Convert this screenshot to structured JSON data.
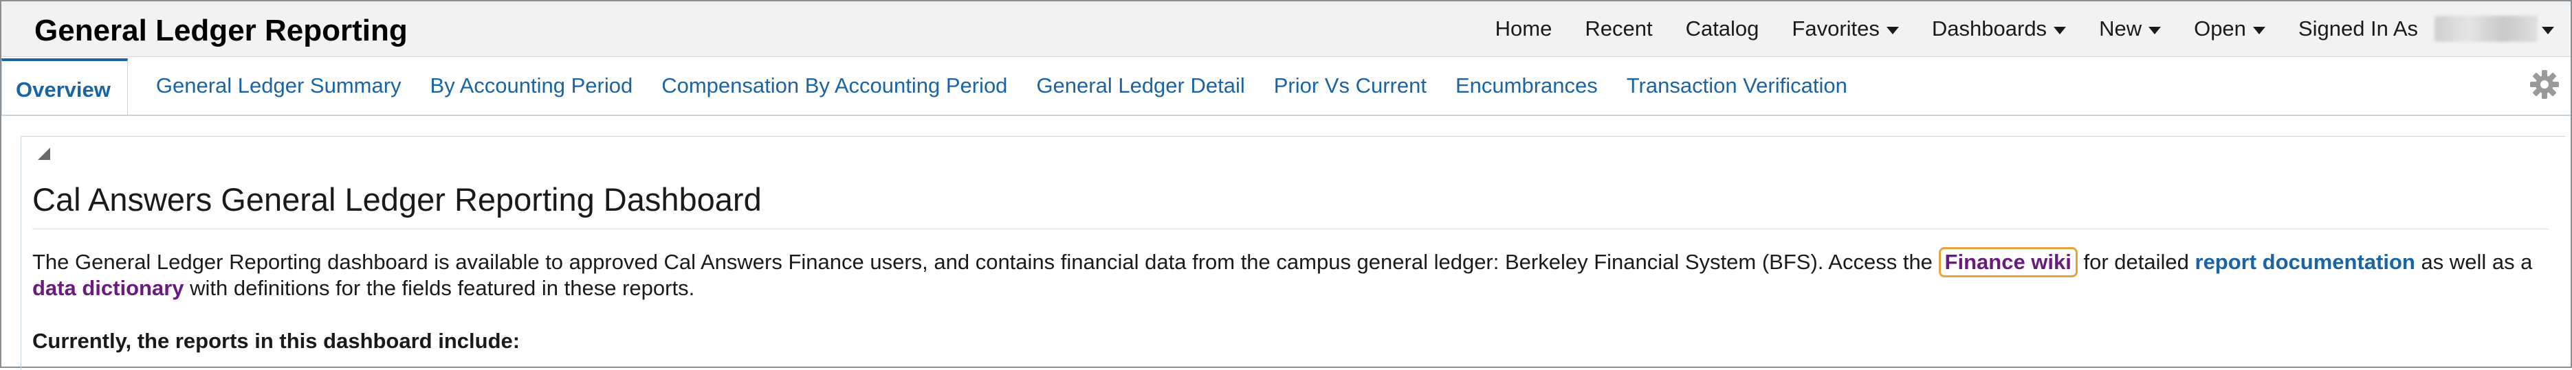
{
  "header": {
    "app_title": "General Ledger Reporting",
    "nav": [
      {
        "label": "Home",
        "dropdown": false
      },
      {
        "label": "Recent",
        "dropdown": false
      },
      {
        "label": "Catalog",
        "dropdown": false
      },
      {
        "label": "Favorites",
        "dropdown": true
      },
      {
        "label": "Dashboards",
        "dropdown": true
      },
      {
        "label": "New",
        "dropdown": true
      },
      {
        "label": "Open",
        "dropdown": true
      }
    ],
    "signed_in_label": "Signed In As"
  },
  "tabs": [
    {
      "label": "Overview",
      "active": true
    },
    {
      "label": "General Ledger Summary",
      "active": false
    },
    {
      "label": "By Accounting Period",
      "active": false
    },
    {
      "label": "Compensation By Accounting Period",
      "active": false
    },
    {
      "label": "General Ledger Detail",
      "active": false
    },
    {
      "label": "Prior Vs Current",
      "active": false
    },
    {
      "label": "Encumbrances",
      "active": false
    },
    {
      "label": "Transaction Verification",
      "active": false
    }
  ],
  "content": {
    "title": "Cal Answers General Ledger Reporting Dashboard",
    "para_text_1": "The General Ledger Reporting dashboard is available to approved Cal Answers Finance users, and contains financial data from the campus general ledger: Berkeley Financial System (BFS). Access the ",
    "link_finance_wiki": "Finance wiki",
    "para_text_2": " for detailed ",
    "link_report_documentation": "report documentation",
    "para_text_3": " as well as a ",
    "link_data_dictionary": "data dictionary",
    "para_text_4": " with definitions for the fields featured in these reports.",
    "subheading": "Currently, the reports in this dashboard include:"
  },
  "colors": {
    "accent_blue": "#1a64a5",
    "link_purple": "#6a1b7e",
    "highlight_orange": "#e8a43a",
    "header_bg": "#f2f2f2"
  }
}
